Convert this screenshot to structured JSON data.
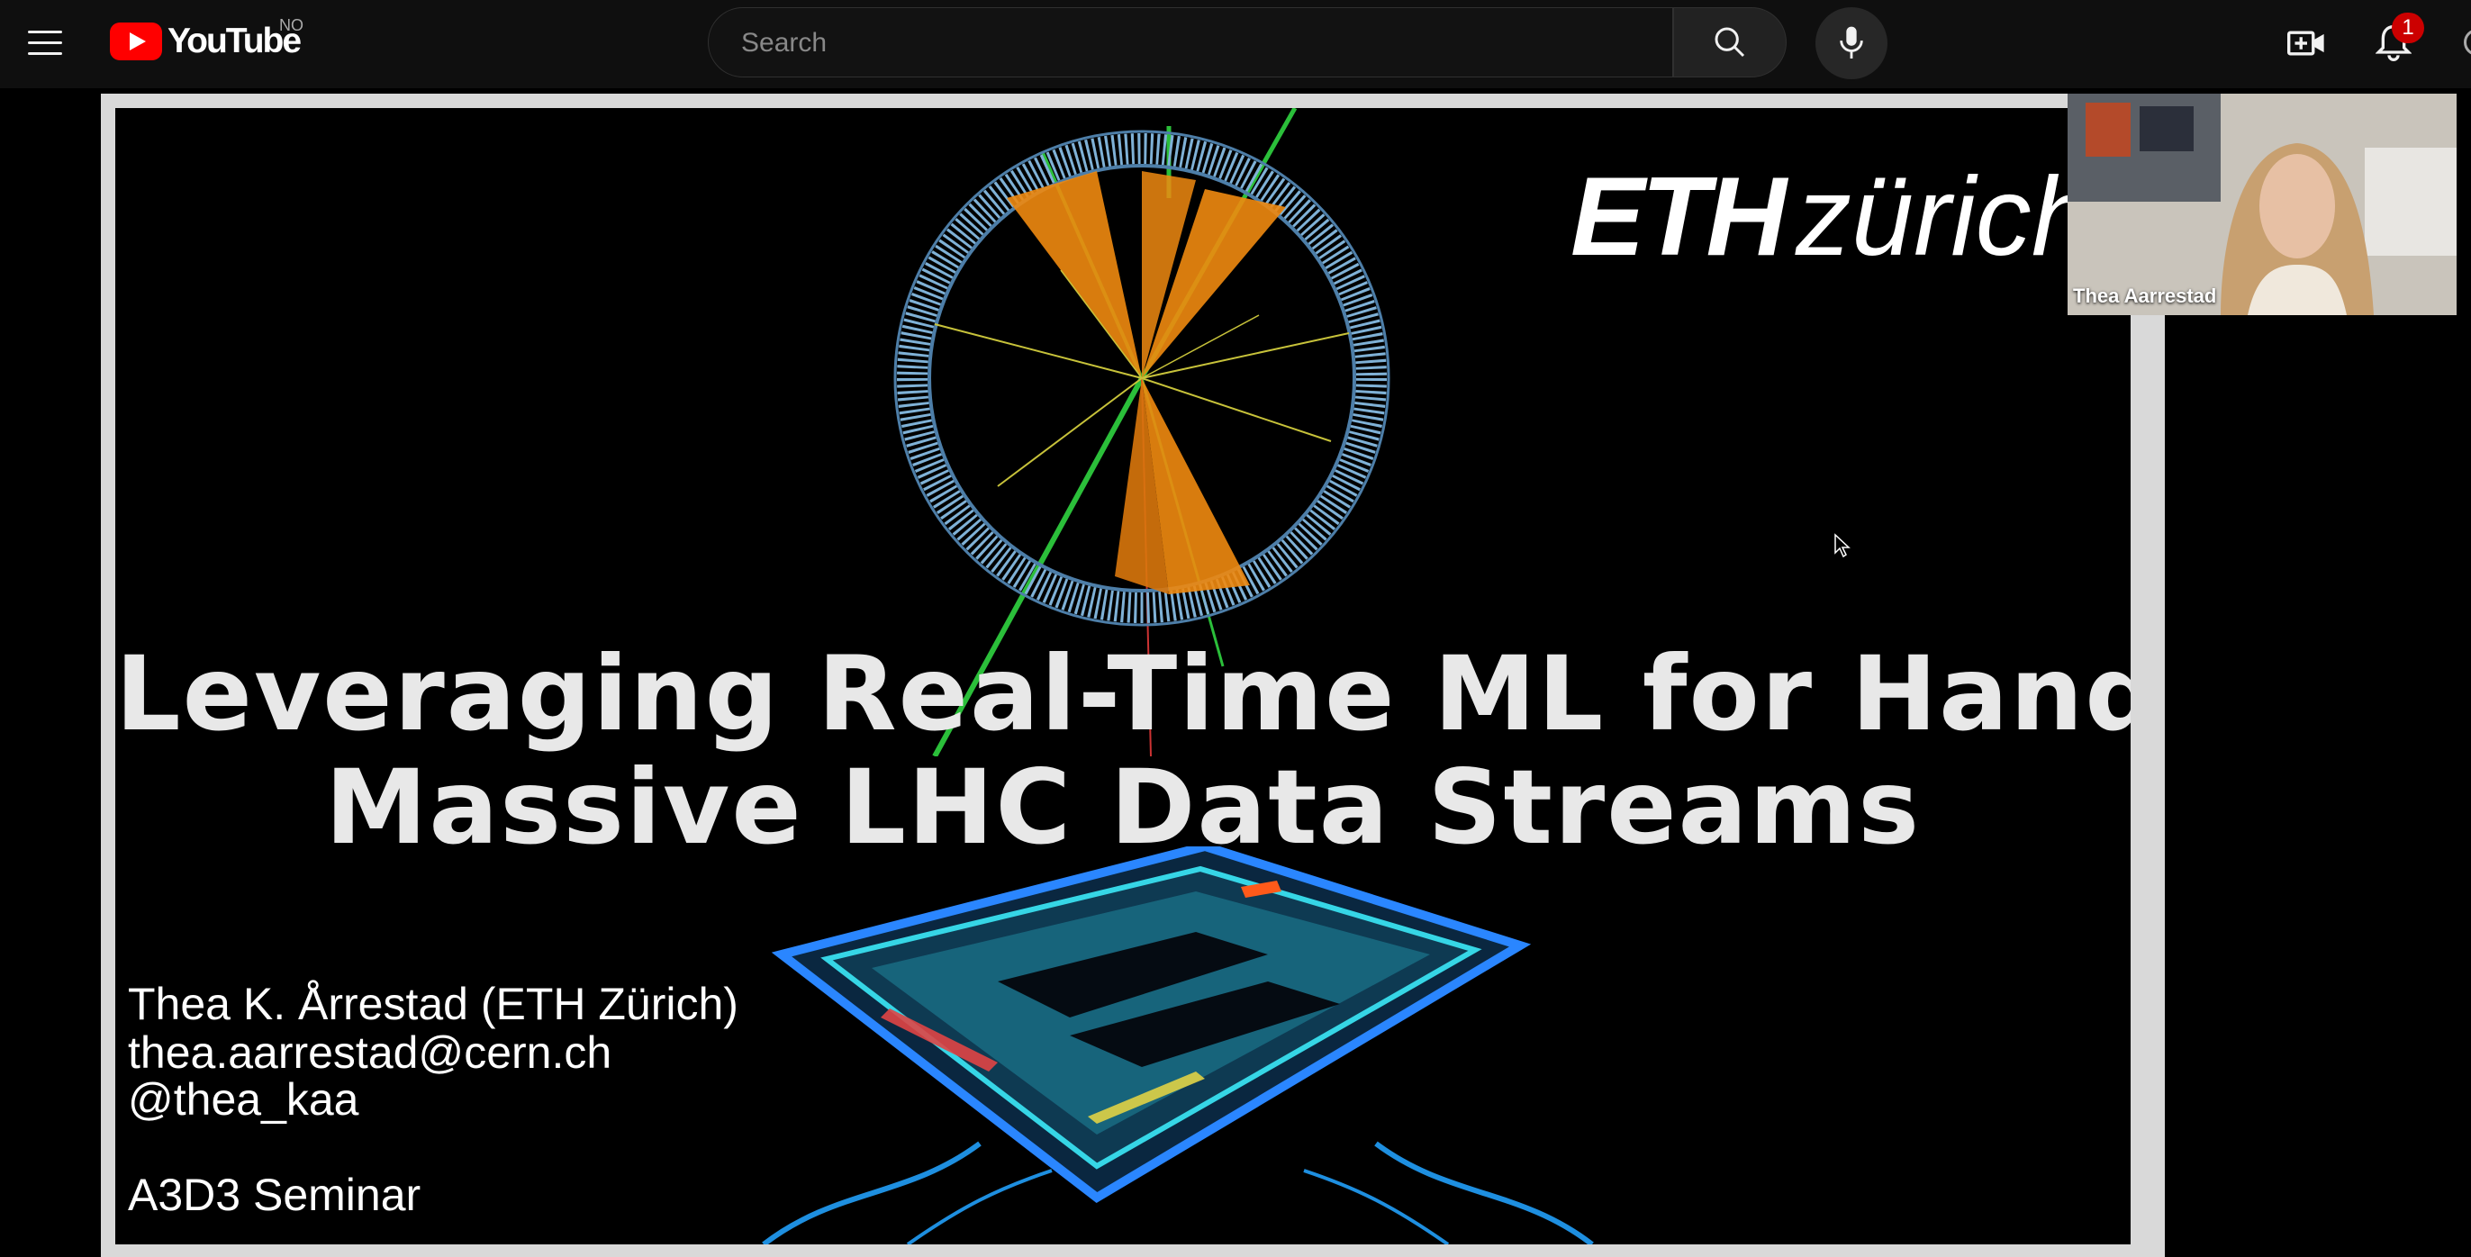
{
  "header": {
    "logo_text": "YouTube",
    "country_code": "NO",
    "search_placeholder": "Search",
    "notification_count": "1"
  },
  "slide": {
    "logo_bold": "ETH",
    "logo_light": "zürich",
    "title_line1": "Leveraging Real-Time ML for Handling",
    "title_line2": "Massive LHC Data Streams",
    "author_name": "Thea K. Årrestad (ETH Zürich)",
    "author_email": "thea.aarrestad@cern.ch",
    "author_handle": "@thea_kaa",
    "event": "A3D3 Seminar"
  },
  "speaker": {
    "name": "Thea Aarrestad"
  },
  "icons": [
    "menu-icon",
    "youtube-logo-icon",
    "search-icon",
    "microphone-icon",
    "create-video-icon",
    "bell-icon",
    "mouse-cursor-icon"
  ],
  "colors": {
    "youtube_red": "#ff0000",
    "badge_red": "#cc0000",
    "background": "#0f0f0f",
    "detector_orange": "#f08a10",
    "chip_cyan": "#36d6e6"
  }
}
